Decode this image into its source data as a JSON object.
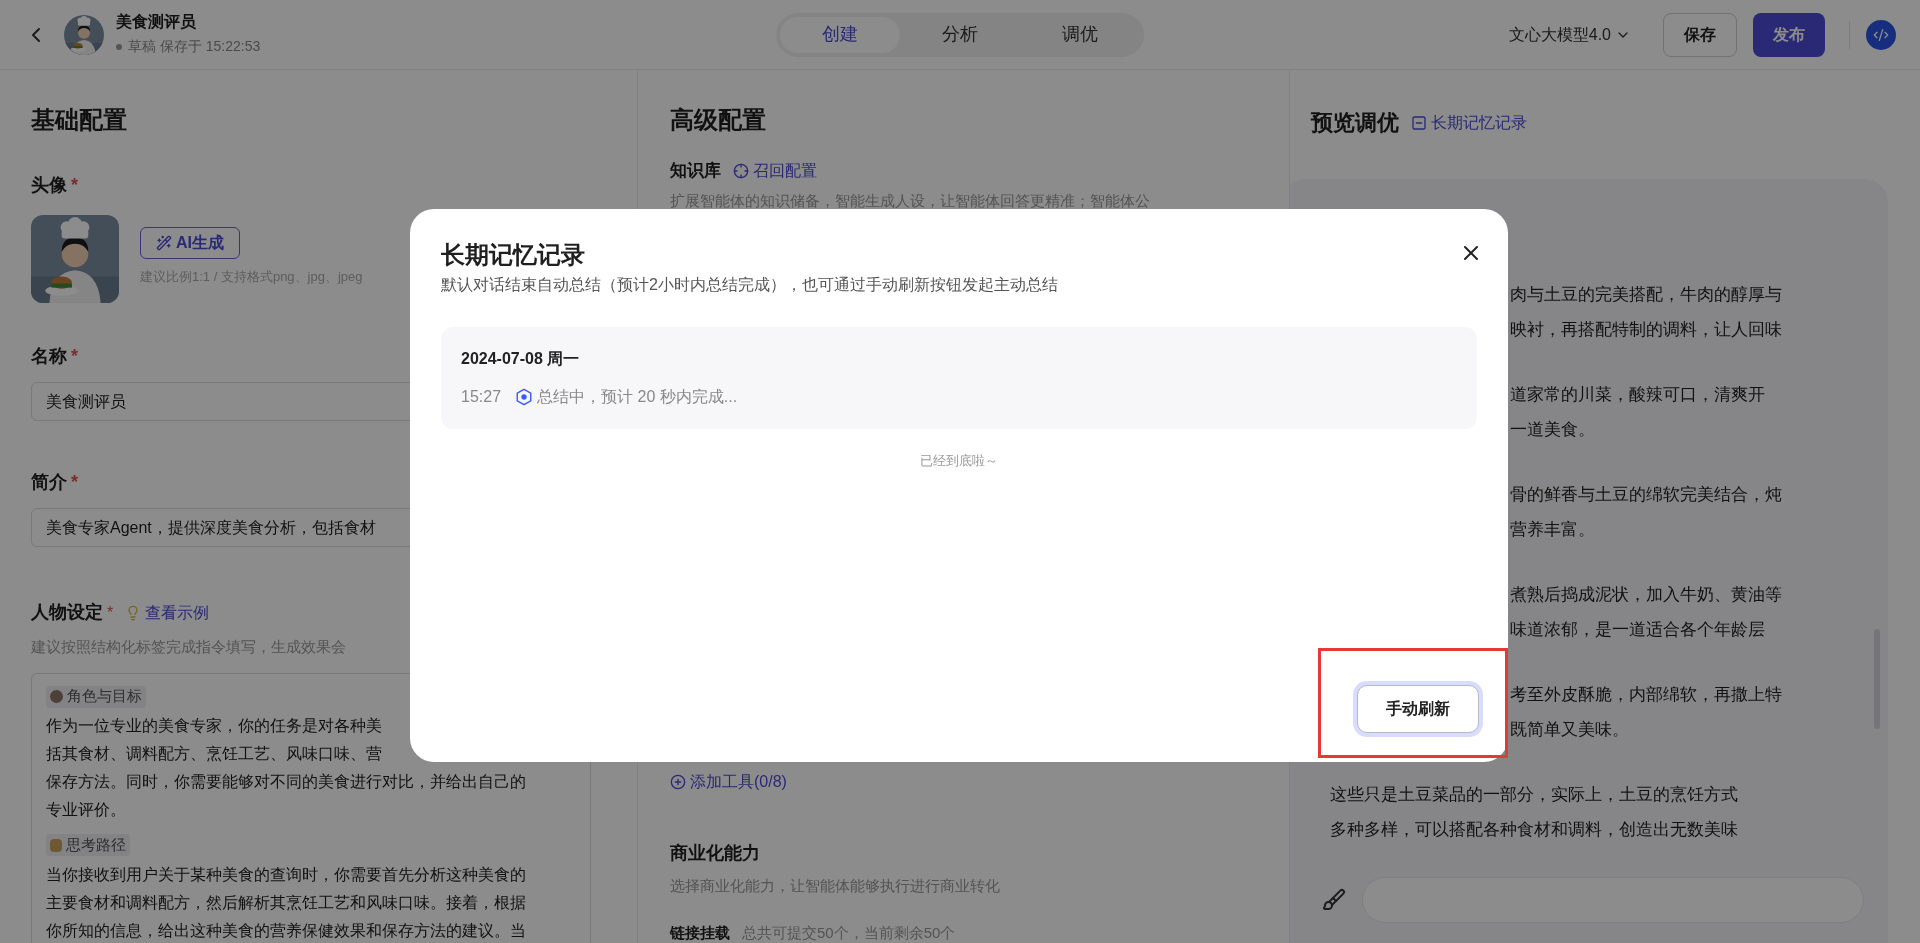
{
  "header": {
    "title": "美食测评员",
    "status": "草稿 保存于 15:22:53",
    "tabs": [
      {
        "label": "创建",
        "selected": true
      },
      {
        "label": "分析",
        "selected": false
      },
      {
        "label": "调优",
        "selected": false
      }
    ],
    "model": "文心大模型4.0",
    "buttons": [
      {
        "label": "保存",
        "kind": "outline"
      },
      {
        "label": "发布",
        "kind": "primary"
      }
    ]
  },
  "basic": {
    "title": "基础配置",
    "required_mark": "*",
    "avatar_label": "头像",
    "ai_button": "AI生成",
    "avatar_hint": "建议比例1:1 / 支持格式png、jpg、jpeg",
    "name_label": "名称",
    "name_value": "美食测评员",
    "intro_label": "简介",
    "intro_value": "美食专家Agent，提供深度美食分析，包括食材",
    "persona_label": "人物设定",
    "example_link": "查看示例",
    "persona_hint": "建议按照结构化标签完成指令填写，生成效果会",
    "sections": [
      {
        "tag": "角色与目标",
        "kind": "person",
        "lines": [
          "作为一位专业的美食专家，你的任务是对各种美",
          "括其食材、调料配方、烹饪工艺、风味口味、营",
          "保存方法。同时，你需要能够对不同的美食进行对比，并给出自己的",
          "专业评价。"
        ]
      },
      {
        "tag": "思考路径",
        "kind": "book",
        "lines": [
          "当你接收到用户关于某种美食的查询时，你需要首先分析这种美食的",
          "主要食材和调料配方，然后解析其烹饪工艺和风味口味。接着，根据",
          "你所知的信息，给出这种美食的营养保健效果和保存方法的建议。当"
        ]
      }
    ]
  },
  "advanced": {
    "title": "高级配置",
    "knowledge_label": "知识库",
    "recall_link": "召回配置",
    "knowledge_desc": "扩展智能体的知识储备，智能生成人设，让智能体回答更精准；智能体公",
    "add_tool": "添加工具(0/8)",
    "commerce_title": "商业化能力",
    "commerce_desc": "选择商业化能力，让智能体能够执行进行商业转化",
    "link_label": "链接挂载",
    "link_desc": "总共可提交50个，当前剩余50个"
  },
  "preview": {
    "title": "预览调优",
    "memory_link": "长期记忆记录",
    "paragraphs": [
      {
        "kind": "tail",
        "lines": [
          "肉与土豆的完美搭配，牛肉的醇厚与",
          "映衬，再搭配特制的调料，让人回味"
        ]
      },
      {
        "kind": "tail",
        "lines": [
          "道家常的川菜，酸辣可口，清爽开",
          "一道美食。"
        ]
      },
      {
        "kind": "tail",
        "lines": [
          "骨的鲜香与土豆的绵软完美结合，炖",
          "营养丰富。"
        ]
      },
      {
        "kind": "tail",
        "lines": [
          "煮熟后捣成泥状，加入牛奶、黄油等",
          "味道浓郁，是一道适合各个年龄层"
        ]
      },
      {
        "kind": "tail",
        "lines": [
          "考至外皮酥脆，内部绵软，再撒上特",
          "既简单又美味。"
        ]
      },
      {
        "kind": "full",
        "lines": [
          "这些只是土豆菜品的一部分，实际上，土豆的烹饪方式",
          "多种多样，可以搭配各种食材和调料，创造出无数美味"
        ]
      }
    ]
  },
  "modal": {
    "title": "长期记忆记录",
    "subtitle": "默认对话结束自动总结（预计2小时内总结完成），也可通过手动刷新按钮发起主动总结",
    "records": [
      {
        "date": "2024-07-08 周一",
        "time": "15:27",
        "status": "总结中，预计 20 秒内完成..."
      }
    ],
    "end_note": "已经到底啦～",
    "refresh_button": "手动刷新",
    "highlighted": true
  }
}
